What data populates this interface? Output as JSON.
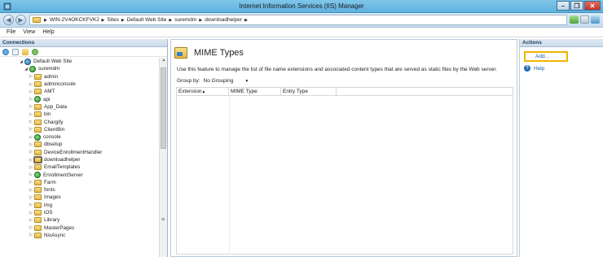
{
  "window": {
    "title": "Internet Information Services (IIS) Manager",
    "min": "–",
    "max": "❐",
    "close": "✕"
  },
  "address": {
    "crumbs": [
      "WIN-2V4OKCKFVKJ",
      "Sites",
      "Default Web Site",
      "suremdm",
      "downloadhelper"
    ]
  },
  "menu": [
    "File",
    "View",
    "Help"
  ],
  "connections": {
    "title": "Connections",
    "tree": [
      {
        "label": "Default Web Site",
        "level": 1,
        "icon": "site",
        "twisty": "◢"
      },
      {
        "label": "suremdm",
        "level": 2,
        "icon": "app",
        "twisty": "◢"
      },
      {
        "label": "admin",
        "level": 3,
        "icon": "folder",
        "twisty": "▷"
      },
      {
        "label": "adminconsole",
        "level": 3,
        "icon": "folder",
        "twisty": "▷"
      },
      {
        "label": "AMT",
        "level": 3,
        "icon": "folder",
        "twisty": "▷"
      },
      {
        "label": "api",
        "level": 3,
        "icon": "app",
        "twisty": "▷"
      },
      {
        "label": "App_Data",
        "level": 3,
        "icon": "folder",
        "twisty": "▷"
      },
      {
        "label": "bin",
        "level": 3,
        "icon": "folder",
        "twisty": "▷"
      },
      {
        "label": "Chargify",
        "level": 3,
        "icon": "folder",
        "twisty": "▷"
      },
      {
        "label": "ClientBin",
        "level": 3,
        "icon": "folder",
        "twisty": "▷"
      },
      {
        "label": "console",
        "level": 3,
        "icon": "app",
        "twisty": "▷"
      },
      {
        "label": "dbsetup",
        "level": 3,
        "icon": "folder",
        "twisty": "▷"
      },
      {
        "label": "DeviceEnrollmentHandler",
        "level": 3,
        "icon": "folder",
        "twisty": "▷"
      },
      {
        "label": "downloadhelper",
        "level": 3,
        "icon": "selected",
        "twisty": "▷"
      },
      {
        "label": "EmailTemplates",
        "level": 3,
        "icon": "folder",
        "twisty": "▷"
      },
      {
        "label": "EnrollmentServer",
        "level": 3,
        "icon": "app",
        "twisty": "▷"
      },
      {
        "label": "Farm",
        "level": 3,
        "icon": "folder",
        "twisty": "▷"
      },
      {
        "label": "fonts",
        "level": 3,
        "icon": "folder",
        "twisty": "▷"
      },
      {
        "label": "Images",
        "level": 3,
        "icon": "folder",
        "twisty": "▷"
      },
      {
        "label": "img",
        "level": 3,
        "icon": "folder",
        "twisty": "▷"
      },
      {
        "label": "iOS",
        "level": 3,
        "icon": "folder",
        "twisty": "▷"
      },
      {
        "label": "Library",
        "level": 3,
        "icon": "folder",
        "twisty": "▷"
      },
      {
        "label": "MasterPages",
        "level": 3,
        "icon": "folder",
        "twisty": "▷"
      },
      {
        "label": "NixAsync",
        "level": 3,
        "icon": "folder",
        "twisty": "▷"
      }
    ]
  },
  "feature": {
    "title": "MIME Types",
    "description": "Use this feature to manage the list of file name extensions and associated content types that are served as static files by the Web server.",
    "group_by_label": "Group by:",
    "group_by_value": "No Grouping",
    "columns": [
      "Extension",
      "MIME Type",
      "Entry Type"
    ]
  },
  "actions": {
    "title": "Actions",
    "add": "Add...",
    "help": "Help"
  },
  "colors": {
    "accent": "#1a5ea8",
    "highlight": "#f1b400",
    "titlebar": "#6bbbe4"
  }
}
